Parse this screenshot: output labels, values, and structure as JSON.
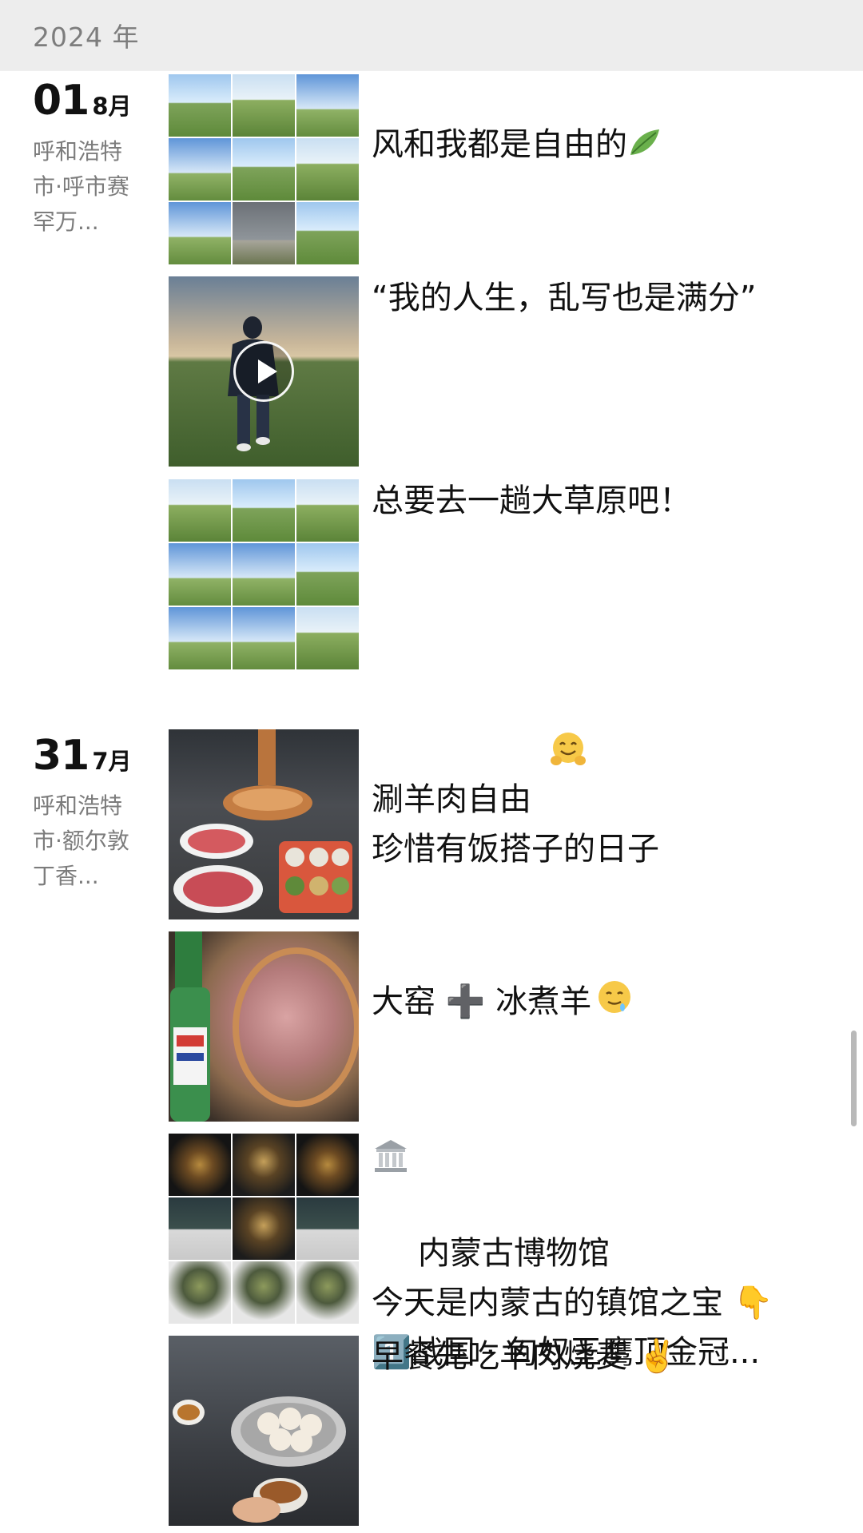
{
  "header": {
    "year": "2024 年"
  },
  "groups": [
    {
      "day": "01",
      "month": "8月",
      "location": "呼和浩特市·呼市赛罕万...",
      "posts": [
        {
          "type": "grid9",
          "caption": "风和我都是自由的",
          "caption_icon": "leaf-icon"
        },
        {
          "type": "video",
          "caption": "“我的人生，乱写也是满分”"
        },
        {
          "type": "grid9",
          "caption": "总要去一趟大草原吧！"
        }
      ]
    },
    {
      "day": "31",
      "month": "7月",
      "location": "呼和浩特市·额尔敦丁香...",
      "posts": [
        {
          "type": "single",
          "caption": "涮羊肉自由\n珍惜有饭搭子的日子",
          "caption_icon": "hugging-face-icon"
        },
        {
          "type": "single",
          "caption": "大窑 ➕ 冰煮羊",
          "caption_icon": "drooling-face-icon"
        },
        {
          "type": "grid9",
          "caption": "内蒙古博物馆\n今天是内蒙古的镇馆之宝 👇\n1️⃣战国 · 匈奴王鹰顶金冠...",
          "caption_icon": "classical-building-icon"
        },
        {
          "type": "single",
          "caption": "早餐先吃羊肉烧麦 ✌️"
        }
      ]
    }
  ],
  "colors": {
    "header_bg": "#ededed",
    "secondary_text": "#7c7c7c",
    "primary_text": "#111111"
  }
}
